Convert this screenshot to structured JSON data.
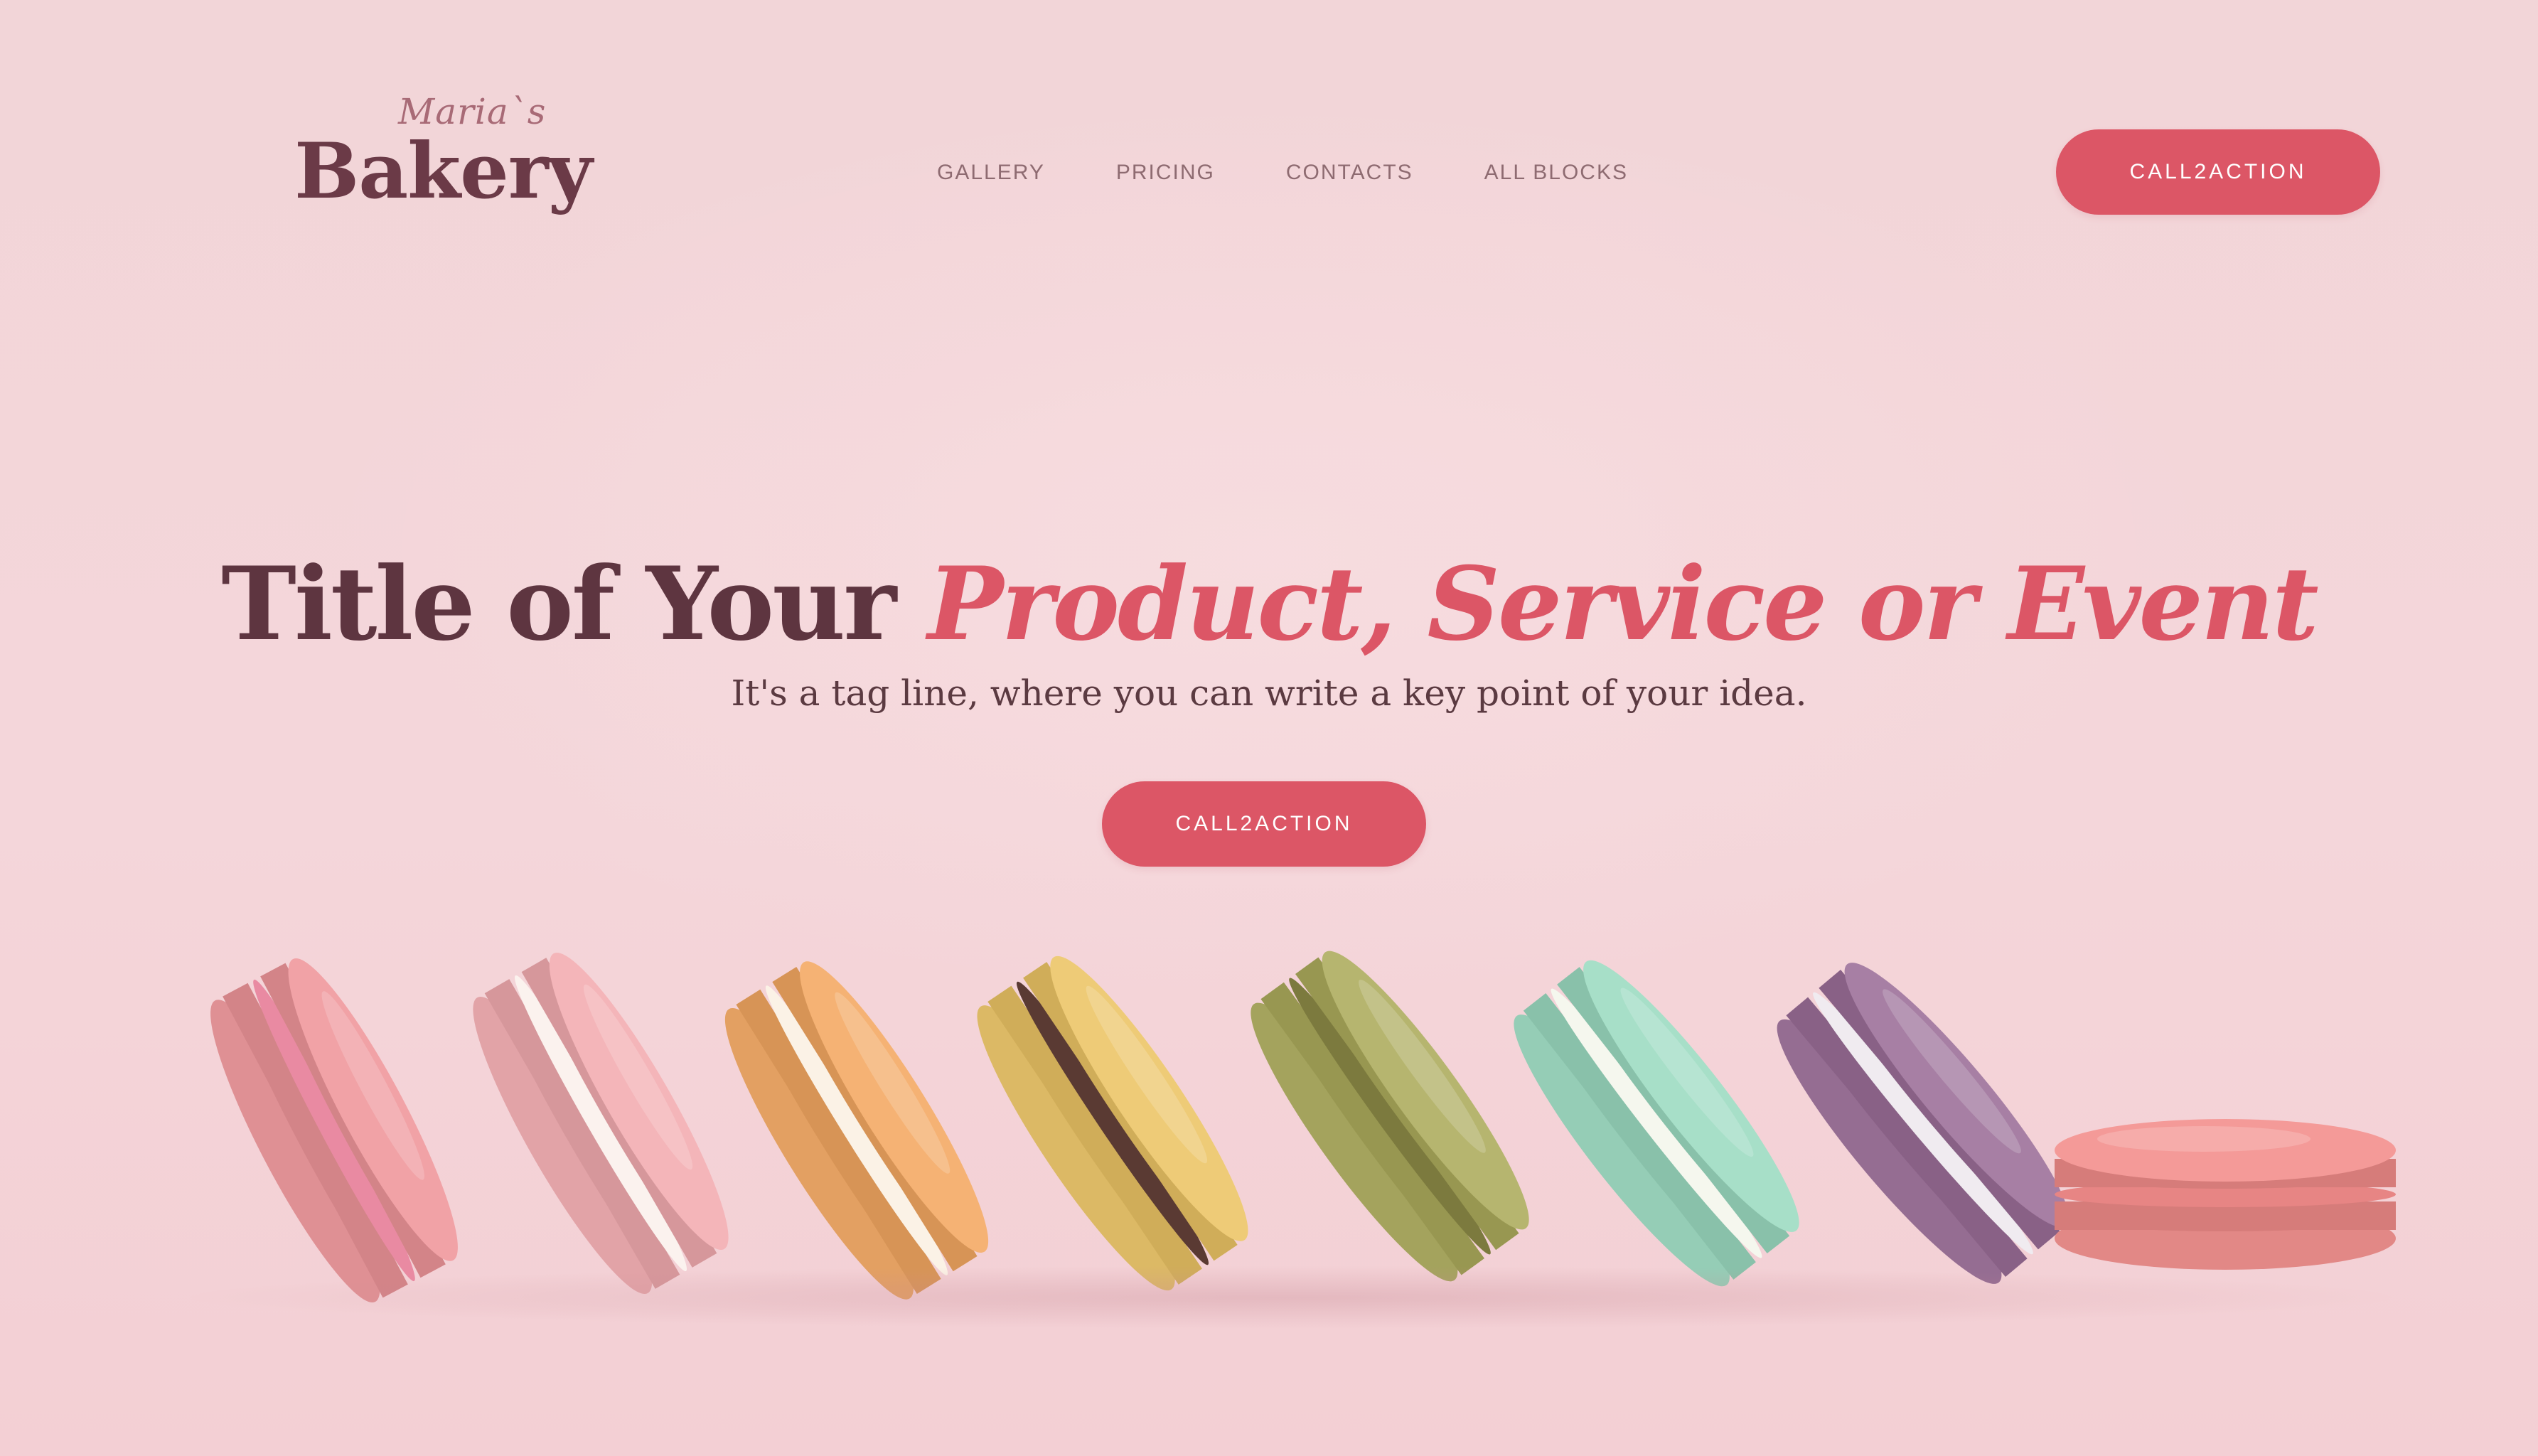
{
  "logo": {
    "script": "Maria`s",
    "main": "Bakery"
  },
  "nav": {
    "items": [
      {
        "label": "GALLERY"
      },
      {
        "label": "PRICING"
      },
      {
        "label": "CONTACTS"
      },
      {
        "label": "ALL BLOCKS"
      }
    ]
  },
  "header": {
    "cta_label": "CALL2ACTION"
  },
  "hero": {
    "title_dark": "Title of Your ",
    "title_accent": "Product, Service or Event",
    "tagline": "It's a tag line, where you can write a key point of your idea.",
    "cta_label": "CALL2ACTION"
  },
  "colors": {
    "background": "#f3d4d8",
    "accent": "#dc5666",
    "dark": "#5e3540"
  },
  "macarons": [
    {
      "name": "pink-macaron",
      "shell": "#f1a2a6",
      "filling": "#e98aa2"
    },
    {
      "name": "light-pink-macaron",
      "shell": "#f4b5b9",
      "filling": "#fbf2ee"
    },
    {
      "name": "orange-macaron",
      "shell": "#f5b274",
      "filling": "#fbf2e6"
    },
    {
      "name": "yellow-macaron",
      "shell": "#eecb77",
      "filling": "#5a3a33"
    },
    {
      "name": "olive-macaron",
      "shell": "#b6b56f",
      "filling": "#7c7a3e"
    },
    {
      "name": "mint-macaron",
      "shell": "#a7dfc8",
      "filling": "#f5f7ee"
    },
    {
      "name": "purple-macaron",
      "shell": "#a77fa4",
      "filling": "#f0ebf0"
    },
    {
      "name": "coral-macaron",
      "shell": "#f49a98",
      "filling": "#e78584"
    }
  ]
}
